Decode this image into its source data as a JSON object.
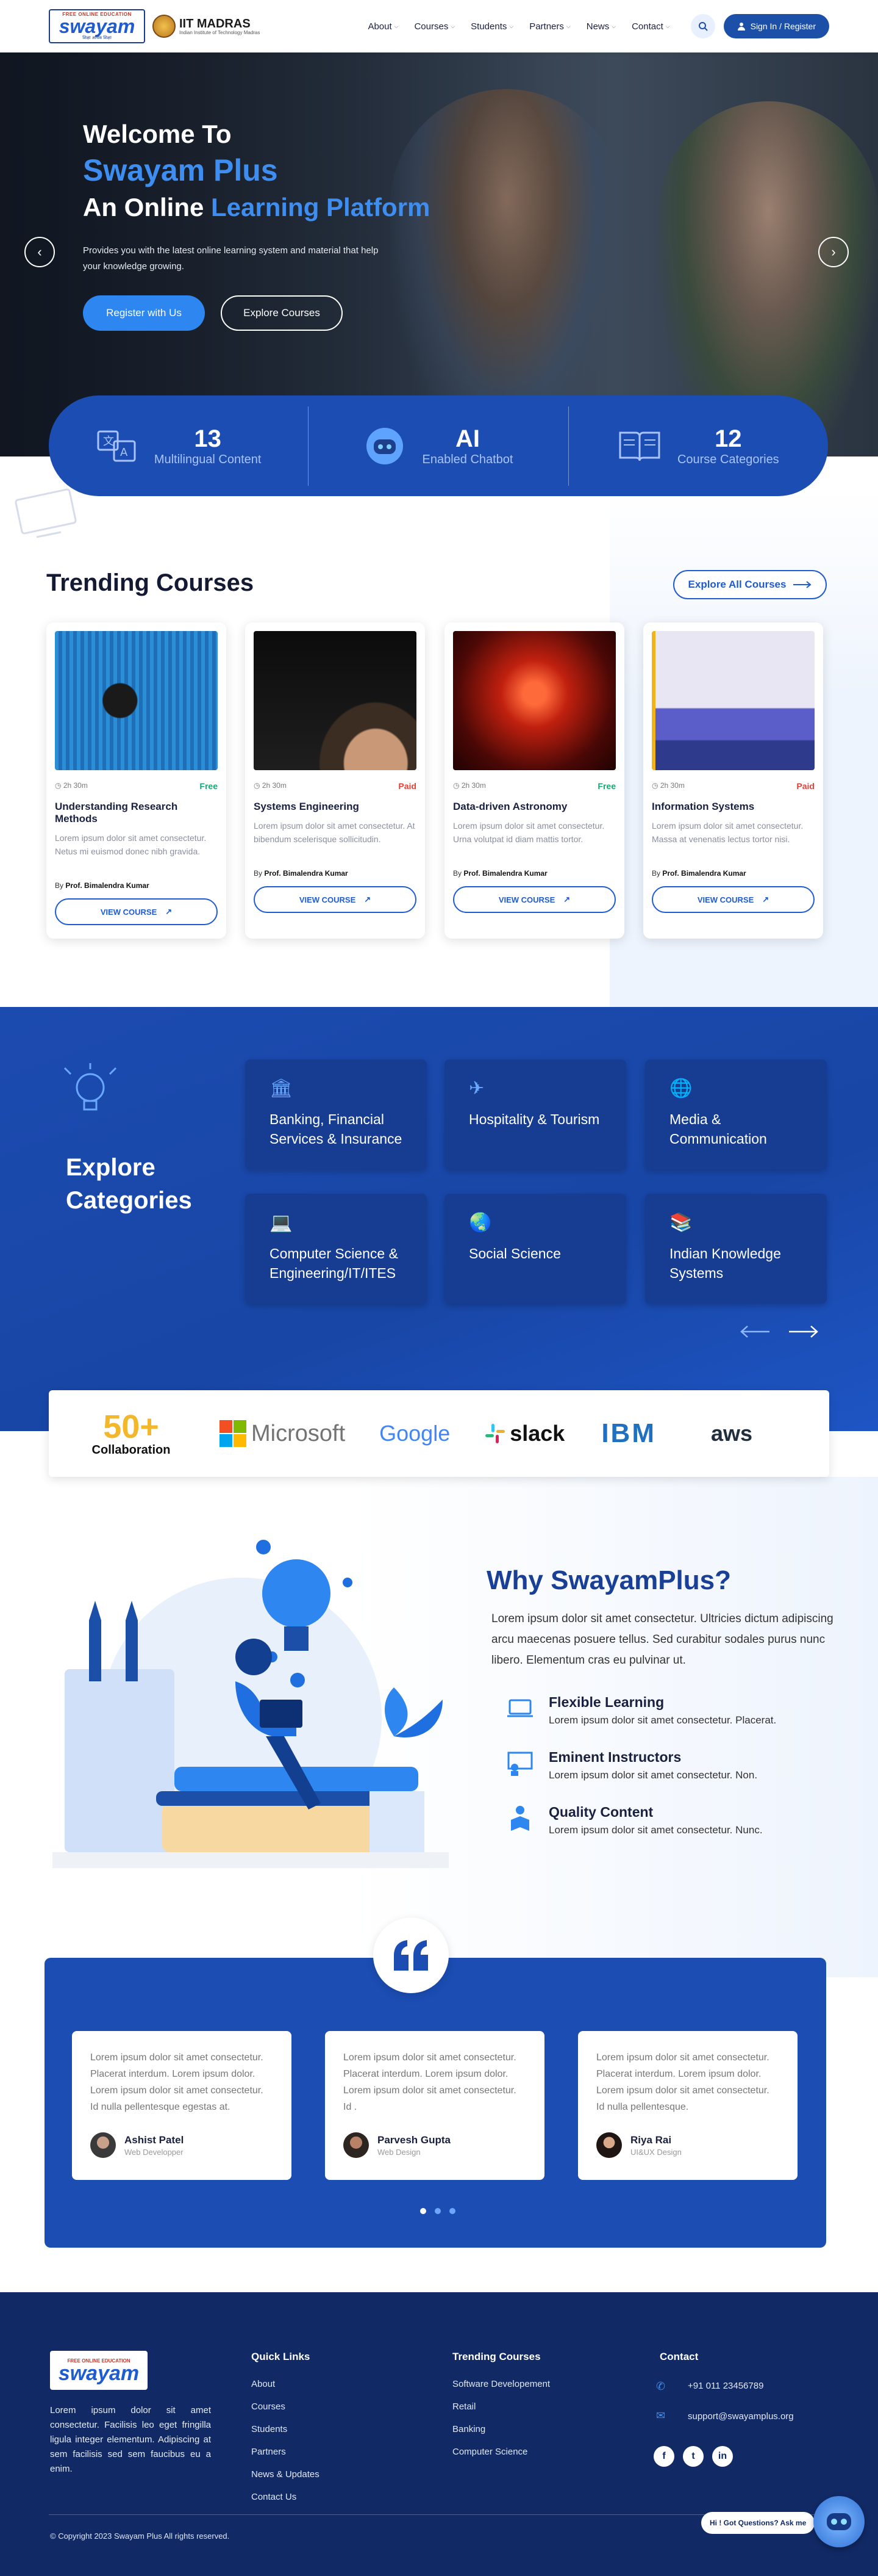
{
  "header": {
    "logo_tag": "FREE ONLINE EDUCATION",
    "logo_word": "swayam",
    "logo_sub": "शिक्षा अधिक शिक्षा",
    "iit_title": "IIT MADRAS",
    "iit_sub": "Indian Institute of Technology Madras",
    "nav": [
      "About",
      "Courses",
      "Students",
      "Partners",
      "News",
      "Contact"
    ],
    "signin_label": "Sign In / Register"
  },
  "hero": {
    "welcome": "Welcome To",
    "brand": "Swayam Plus",
    "online_prefix": "An Online",
    "online_highlight": "Learning Platform",
    "description": "Provides you with the latest online learning system and material that help your knowledge growing.",
    "register_btn": "Register with Us",
    "explore_btn": "Explore Courses"
  },
  "stats": [
    {
      "num": "13",
      "label": "Multilingual Content",
      "icon": "translate-icon"
    },
    {
      "num": "AI",
      "label": "Enabled  Chatbot",
      "icon": "chatbot-icon"
    },
    {
      "num": "12",
      "label": "Course Categories",
      "icon": "book-icon"
    }
  ],
  "trending": {
    "title": "Trending Courses",
    "explore_all": "Explore All Courses",
    "view_label": "VIEW COURSE",
    "by_prefix": "By",
    "courses": [
      {
        "duration": "2h 30m",
        "price": "Free",
        "price_color": "#19a974",
        "title": "Understanding Research Methods",
        "desc": "Lorem ipsum dolor sit amet consectetur. Netus mi euismod donec nibh gravida.",
        "author": "Prof. Bimalendra Kumar"
      },
      {
        "duration": "2h 30m",
        "price": "Paid",
        "price_color": "#e0433a",
        "title": "Systems Engineering",
        "desc": "Lorem ipsum dolor sit amet consectetur. At bibendum scelerisque sollicitudin.",
        "author": "Prof. Bimalendra Kumar"
      },
      {
        "duration": "2h 30m",
        "price": "Free",
        "price_color": "#19a974",
        "title": "Data-driven Astronomy",
        "desc": "Lorem ipsum dolor sit amet consectetur. Urna volutpat id diam mattis tortor.",
        "author": "Prof. Bimalendra Kumar"
      },
      {
        "duration": "2h 30m",
        "price": "Paid",
        "price_color": "#e0433a",
        "title": "Information Systems",
        "desc": "Lorem ipsum dolor sit amet consectetur. Massa at venenatis lectus tortor nisi.",
        "author": "Prof. Bimalendra Kumar"
      }
    ]
  },
  "categories": {
    "title_line1": "Explore",
    "title_line2": "Categories",
    "items": [
      {
        "label": "Banking, Financial Services & Insurance",
        "icon": "bank-icon"
      },
      {
        "label": "Hospitality & Tourism",
        "icon": "plane-icon"
      },
      {
        "label": "Media & Communication",
        "icon": "globe-icon"
      },
      {
        "label": "Computer Science & Engineering/IT/ITES",
        "icon": "laptop-icon"
      },
      {
        "label": "Social  Science",
        "icon": "earth-icon"
      },
      {
        "label": "Indian Knowledge Systems",
        "icon": "books-icon"
      }
    ]
  },
  "partners": {
    "count": "50+",
    "label": "Collaboration",
    "logos": [
      "Microsoft",
      "Google",
      "slack",
      "IBM",
      "aws"
    ]
  },
  "why": {
    "title": "Why SwayamPlus?",
    "text": "Lorem ipsum dolor sit amet consectetur. Ultricies dictum adipiscing arcu maecenas posuere tellus. Sed curabitur sodales purus nunc libero. Elementum cras eu pulvinar ut.",
    "features": [
      {
        "title": "Flexible Learning",
        "desc": "Lorem ipsum dolor sit amet consectetur. Placerat."
      },
      {
        "title": "Eminent Instructors",
        "desc": "Lorem ipsum dolor sit amet consectetur. Non."
      },
      {
        "title": "Quality Content",
        "desc": "Lorem ipsum dolor sit amet consectetur. Nunc."
      }
    ]
  },
  "testimonials": [
    {
      "quote": "Lorem ipsum dolor sit amet consectetur. Placerat interdum. Lorem ipsum dolor. Lorem ipsum dolor sit amet consectetur. Id nulla pellentesque egestas at.",
      "name": "Ashist Patel",
      "role": "Web Developper"
    },
    {
      "quote": "Lorem ipsum dolor sit amet consectetur. Placerat interdum. Lorem ipsum dolor. Lorem ipsum dolor sit amet consectetur. Id .",
      "name": "Parvesh Gupta",
      "role": "Web Design"
    },
    {
      "quote": "Lorem ipsum dolor sit amet consectetur. Placerat interdum. Lorem ipsum dolor. Lorem ipsum dolor sit amet consectetur. Id nulla pellentesque.",
      "name": "Riya Rai",
      "role": "UI&UX Design"
    }
  ],
  "footer": {
    "about": "Lorem ipsum dolor sit amet consectetur. Facilisis leo eget fringilla ligula integer elementum. Adipiscing at sem facilisis sed sem faucibus eu a enim.",
    "quick_title": "Quick Links",
    "quick_links": [
      "About",
      "Courses",
      "Students",
      "Partners",
      "News & Updates",
      "Contact Us"
    ],
    "trending_title": "Trending Courses",
    "trending_links": [
      "Software Developement",
      "Retail",
      "Banking",
      "Computer Science"
    ],
    "contact_title": "Contact",
    "phone": "+91 011 23456789",
    "email": "support@swayamplus.org",
    "copyright": "© Copyright 2023  Swayam Plus  All rights reserved.",
    "chat_prompt": "Hi ! Got Questions? Ask me"
  },
  "colors": {
    "primary": "#1b4db3",
    "accent": "#2e87f0",
    "footer": "#112a66"
  }
}
